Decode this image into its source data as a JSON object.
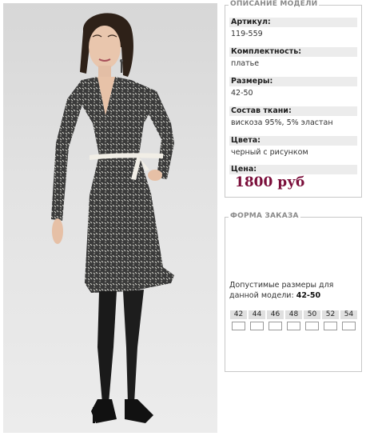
{
  "photo": {
    "icon": "dress-model-photo",
    "colors": {
      "background": "#dcdcdc",
      "dress": "#3b3b3b",
      "belt": "#f1eee6",
      "tights": "#1a1a1a"
    }
  },
  "description": {
    "legend": "ОПИСАНИЕ МОДЕЛИ",
    "article_label": "Артикул:",
    "article_value": "119-559",
    "set_label": "Комплектность:",
    "set_value": "платье",
    "sizes_label": "Размеры:",
    "sizes_value": "42-50",
    "fabric_label": "Состав ткани:",
    "fabric_value": "вискоза 95%, 5% эластан",
    "colors_label": "Цвета:",
    "colors_value": "черный с рисунком",
    "price_label": "Цена:",
    "price_value": "1800 руб",
    "price_color": "#7a0e3a"
  },
  "order": {
    "legend": "ФОРМА ЗАКАЗА",
    "allowed_text": "Допустимые размеры для данной модели:",
    "allowed_range": "42-50",
    "sizes": [
      "42",
      "44",
      "46",
      "48",
      "50",
      "52",
      "54"
    ]
  }
}
